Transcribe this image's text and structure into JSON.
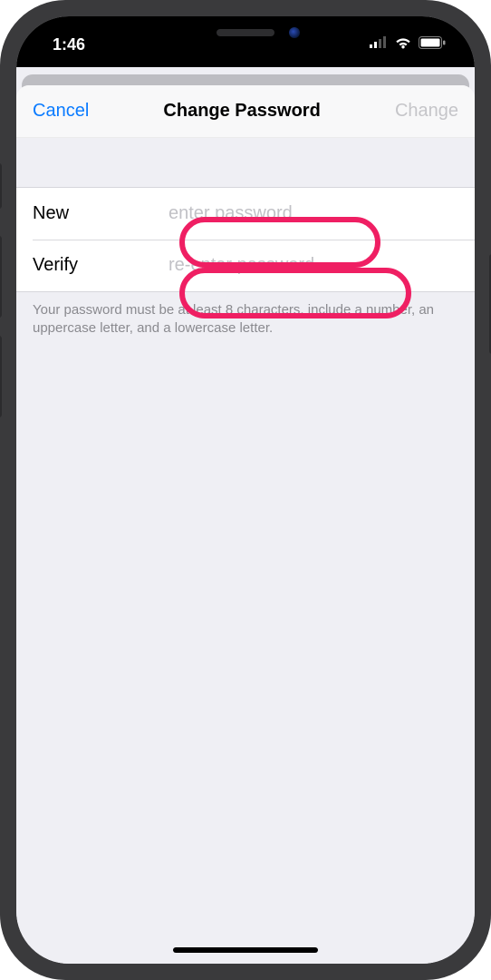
{
  "status": {
    "time": "1:46"
  },
  "nav": {
    "cancel": "Cancel",
    "title": "Change Password",
    "change": "Change"
  },
  "form": {
    "new_label": "New",
    "new_placeholder": "enter password",
    "verify_label": "Verify",
    "verify_placeholder": "re-enter password"
  },
  "footer": "Your password must be at least 8 characters, include a number, an uppercase letter, and a lowercase letter."
}
